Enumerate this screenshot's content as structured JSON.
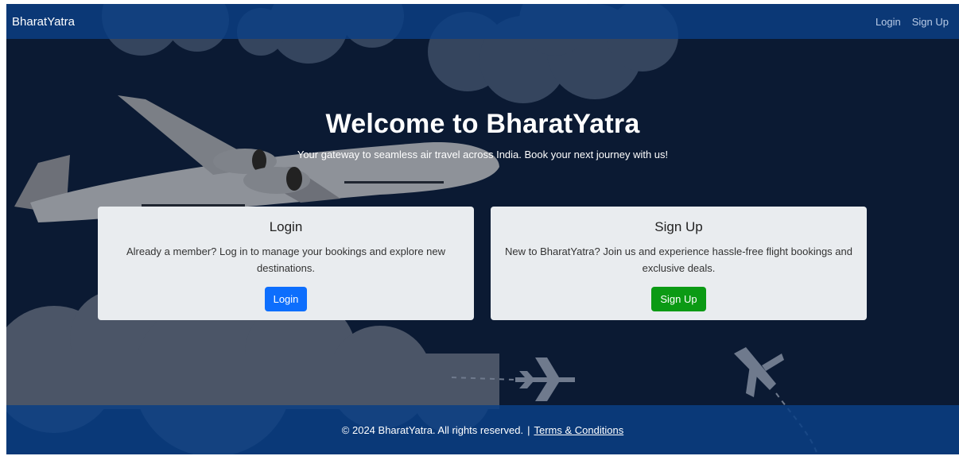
{
  "navbar": {
    "brand": "BharatYatra",
    "links": [
      "Login",
      "Sign Up"
    ]
  },
  "hero": {
    "title": "Welcome to BharatYatra",
    "subtitle": "Your gateway to seamless air travel across India. Book your next journey with us!"
  },
  "cards": {
    "login": {
      "title": "Login",
      "text": "Already a member? Log in to manage your bookings and explore new destinations.",
      "button": "Login"
    },
    "signup": {
      "title": "Sign Up",
      "text": "New to BharatYatra? Join us and experience hassle-free flight bookings and exclusive deals.",
      "button": "Sign Up"
    }
  },
  "footer": {
    "copyright": "© 2024 BharatYatra. All rights reserved.",
    "separator": "|",
    "terms_link": "Terms & Conditions"
  },
  "colors": {
    "navbar": "#0b4085",
    "background": "#0b1a33",
    "login_button": "#0d6efd",
    "signup_button": "#0b9a14"
  },
  "icons": [
    "airplane-illustration",
    "cloud-illustration",
    "small-airplane-icon"
  ]
}
